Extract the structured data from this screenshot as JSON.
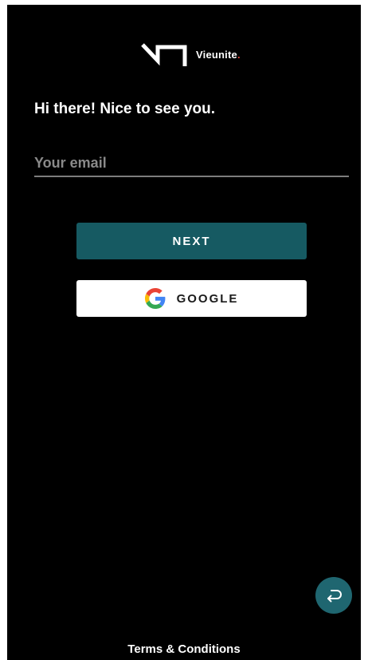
{
  "brand": {
    "name": "Vieunite",
    "dot": ".",
    "logo_icon": "vieunite-logo-icon",
    "dot_color": "#e0463a"
  },
  "login": {
    "greeting": "Hi there! Nice to see you.",
    "email_value": "",
    "email_placeholder": "Your email",
    "next_label": "NEXT",
    "google_label": "GOOGLE",
    "google_icon": "google-icon",
    "next_color": "#165a62"
  },
  "fab": {
    "icon": "return-arrow-icon",
    "color": "#1f6670"
  },
  "footer": {
    "terms_label": "Terms & Conditions"
  }
}
